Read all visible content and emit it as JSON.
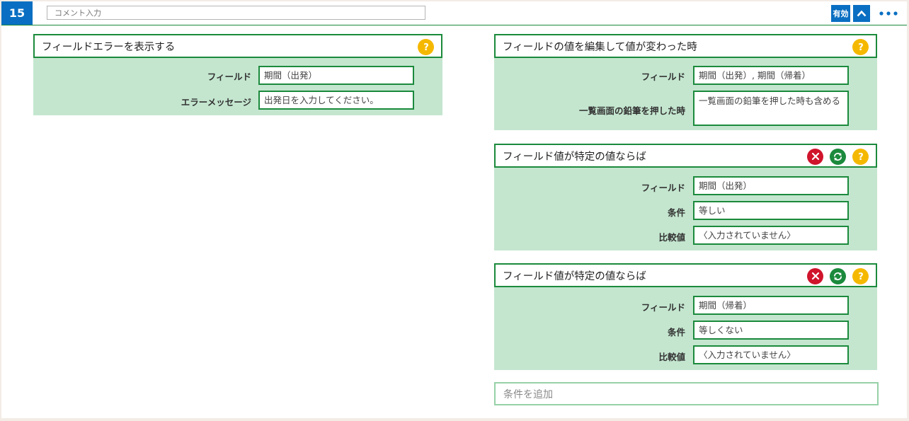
{
  "rule": {
    "number": "15",
    "comment_placeholder": "コメント入力",
    "valid_label": "有効"
  },
  "actions_left": [
    {
      "title": "フィールドエラーを表示する",
      "rows": [
        {
          "label": "フィールド",
          "value": "期間（出発）"
        },
        {
          "label": "エラーメッセージ",
          "value": "出発日を入力してください。"
        }
      ]
    }
  ],
  "triggers": [
    {
      "title": "フィールドの値を編集して値が変わった時",
      "rows": [
        {
          "label": "フィールド",
          "value": "期間（出発）, 期間（帰着）"
        },
        {
          "label": "一覧画面の鉛筆を押した時",
          "value": "一覧画面の鉛筆を押した時も含める"
        }
      ]
    },
    {
      "title": "フィールド値が特定の値ならば",
      "rows": [
        {
          "label": "フィールド",
          "value": "期間（出発）"
        },
        {
          "label": "条件",
          "value": "等しい"
        },
        {
          "label": "比較値",
          "value": "〈入力されていません〉"
        }
      ]
    },
    {
      "title": "フィールド値が特定の値ならば",
      "rows": [
        {
          "label": "フィールド",
          "value": "期間（帰着）"
        },
        {
          "label": "条件",
          "value": "等しくない"
        },
        {
          "label": "比較値",
          "value": "〈入力されていません〉"
        }
      ]
    }
  ],
  "add_condition_label": "条件を追加",
  "icons": {
    "help": "help-icon",
    "delete": "delete-icon",
    "refresh": "refresh-icon",
    "collapse": "chevron-up-icon",
    "more": "more-icon"
  },
  "colors": {
    "accent_blue": "#0a6fc2",
    "border_green": "#1b8a3c",
    "block_bg": "#c4e6cf",
    "help_yellow": "#f5b800",
    "delete_red": "#d0142c",
    "refresh_green": "#1b8a3c"
  }
}
